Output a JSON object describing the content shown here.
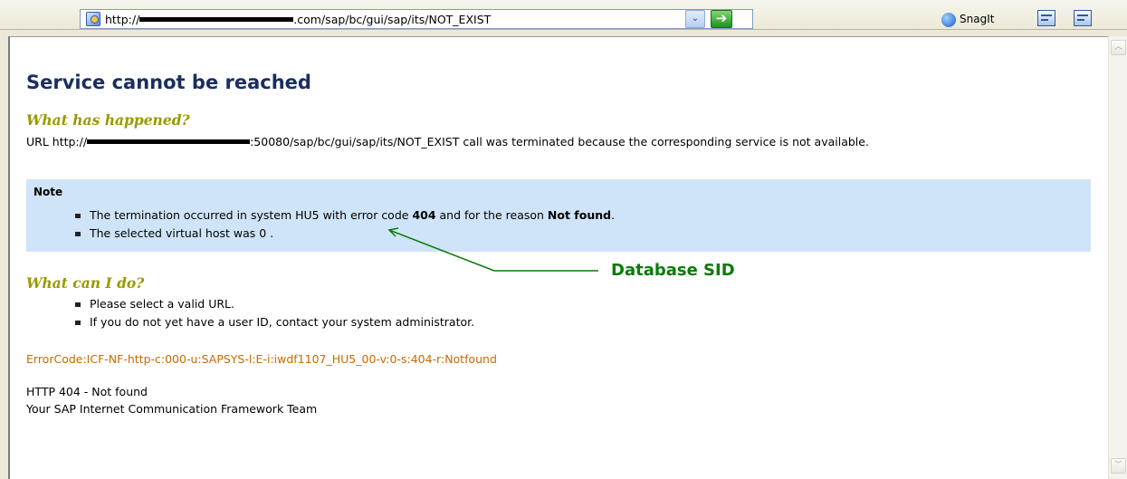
{
  "toolbar": {
    "url_prefix": "http://",
    "url_suffix": ".com/sap/bc/gui/sap/its/NOT_EXIST",
    "dropdown_glyph": "⌄",
    "go_glyph": "➔",
    "snagit_label": "SnagIt"
  },
  "page": {
    "title": "Service cannot be reached",
    "happened_heading": "What has happened?",
    "url_text_prefix": "URL http://",
    "url_text_suffix": ":50080/sap/bc/gui/sap/its/NOT_EXIST call was terminated because the corresponding service is not available.",
    "note": {
      "label": "Note",
      "item1_prefix": "The termination occurred in system HU5 with error code ",
      "item1_code": "404",
      "item1_mid": " and for the reason ",
      "item1_reason": "Not found",
      "item1_end": ".",
      "item2": "The selected virtual host was 0 ."
    },
    "cando_heading": "What can I do?",
    "cando_items": [
      "Please select a valid URL.",
      "If you do not yet have a user ID, contact your system administrator."
    ],
    "error_code": "ErrorCode:ICF-NF-http-c:000-u:SAPSYS-l:E-i:iwdf1107_HU5_00-v:0-s:404-r:Notfound",
    "http_status": "HTTP 404 - Not found",
    "team": "Your SAP Internet Communication Framework Team"
  },
  "annotation": {
    "label": "Database SID",
    "color": "#0a7a0a"
  },
  "colors": {
    "title": "#1a2e60",
    "section_heading": "#999900",
    "note_background": "#cfe4f8",
    "error_code": "#c86a00"
  }
}
